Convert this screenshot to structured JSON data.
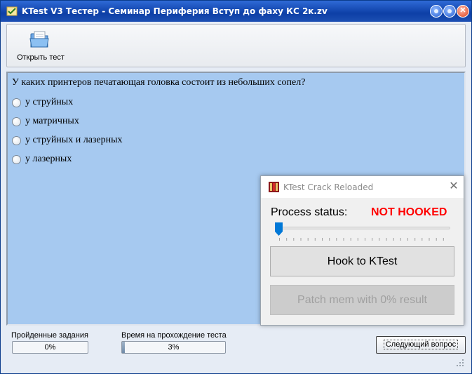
{
  "window": {
    "title": "KTest V3 Тестер - Семинар Периферия Вступ до фаху КС 2к.zv",
    "controls": {
      "minimize": "",
      "maximize": "",
      "close": "✕"
    }
  },
  "toolbar": {
    "open_test_label": "Открыть тест",
    "open_test_icon": "folder-open-icon"
  },
  "question": {
    "text": "У каких принтеров печатающая головка состоит из небольших сопел?",
    "answers": [
      {
        "label": "у струйных",
        "selected": false
      },
      {
        "label": "у матричных",
        "selected": false
      },
      {
        "label": "у струйных и лазерных",
        "selected": false
      },
      {
        "label": "у лазерных",
        "selected": false
      }
    ]
  },
  "crack_dialog": {
    "title": "KTest Crack Reloaded",
    "close": "✕",
    "status_label": "Process status:",
    "status_value": "NOT HOOKED",
    "status_color": "#ff0000",
    "slider_value": 0,
    "hook_button": "Hook to KTest",
    "patch_button": "Patch mem with 0% result",
    "patch_enabled": false
  },
  "status": {
    "completed_label": "Пройденные задания",
    "completed_value": "0%",
    "completed_fraction": 0,
    "time_label": "Время на прохождение теста",
    "time_value": "3%",
    "time_fraction": 0.03,
    "next_button": "Следующий вопрос"
  },
  "colors": {
    "titlebar": "#0d3fa6",
    "question_background": "#a6c9f0",
    "not_hooked": "#ff0000"
  }
}
